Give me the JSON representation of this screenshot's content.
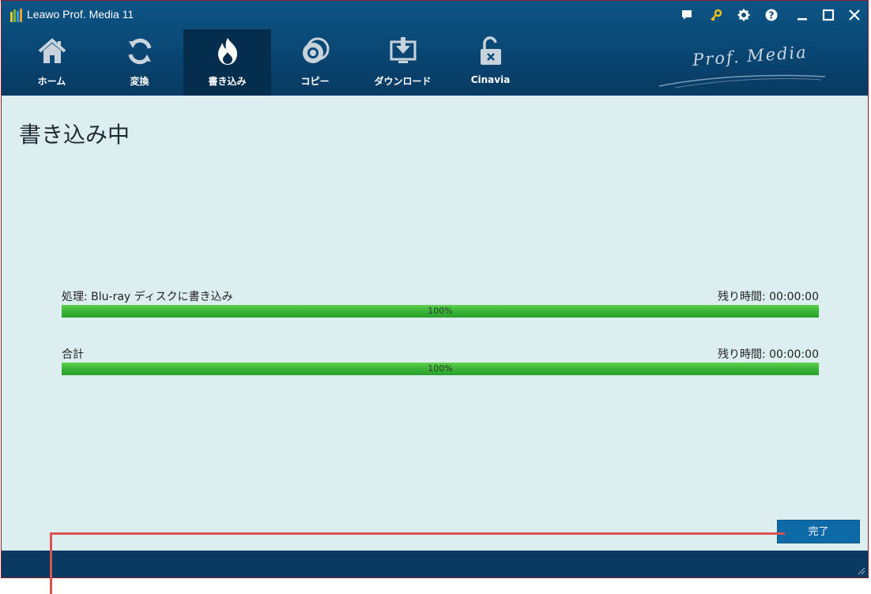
{
  "window": {
    "title": "Leawo Prof. Media 11",
    "brand": "Prof. Media"
  },
  "titlebar_icons": [
    "feedback-icon",
    "key-icon",
    "gear-icon",
    "help-icon",
    "minimize-icon",
    "maximize-icon",
    "close-icon"
  ],
  "nav": {
    "items": [
      {
        "label": "ホーム",
        "icon": "home-icon"
      },
      {
        "label": "変換",
        "icon": "convert-icon"
      },
      {
        "label": "書き込み",
        "icon": "burn-icon",
        "active": true
      },
      {
        "label": "コピー",
        "icon": "copy-disc-icon"
      },
      {
        "label": "ダウンロード",
        "icon": "download-icon"
      },
      {
        "label": "Cinavia",
        "icon": "cinavia-unlock-icon"
      }
    ]
  },
  "main": {
    "title": "書き込み中",
    "progress": [
      {
        "label": "処理: Blu-ray ディスクに書き込み",
        "remaining": "残り時間: 00:00:00",
        "percent_text": "100%",
        "value": 1.0
      },
      {
        "label": "合計",
        "remaining": "残り時間: 00:00:00",
        "percent_text": "100%",
        "value": 1.0
      }
    ],
    "done_button": "完了"
  },
  "colors": {
    "header": "#0a4a78",
    "active_tab": "#052d4e",
    "content_bg": "#ddeef0",
    "progress_fill": "#3db63a",
    "button": "#0e6aa6",
    "callout": "#d9534f"
  }
}
